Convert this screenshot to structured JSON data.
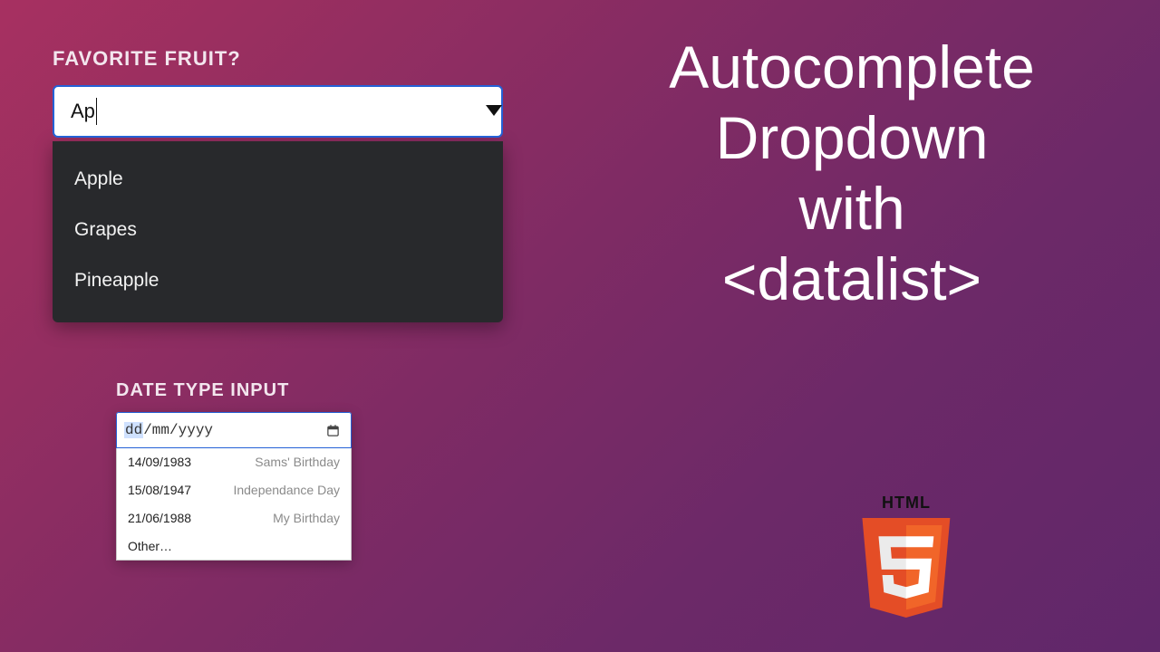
{
  "fruit": {
    "label": "FAVORITE FRUIT?",
    "input_value": "Ap",
    "options": [
      "Apple",
      "Grapes",
      "Pineapple"
    ]
  },
  "date": {
    "label": "DATE TYPE INPUT",
    "placeholder_dd": "dd",
    "placeholder_rest": "/mm/yyyy",
    "options": [
      {
        "value": "14/09/1983",
        "desc": "Sams' Birthday"
      },
      {
        "value": "15/08/1947",
        "desc": "Independance Day"
      },
      {
        "value": "21/06/1988",
        "desc": "My Birthday"
      }
    ],
    "other_label": "Other…"
  },
  "headline": {
    "line1": "Autocomplete",
    "line2": "Dropdown",
    "line3": "with",
    "line4": "<datalist>"
  },
  "logo": {
    "label": "HTML",
    "digit": "5"
  }
}
